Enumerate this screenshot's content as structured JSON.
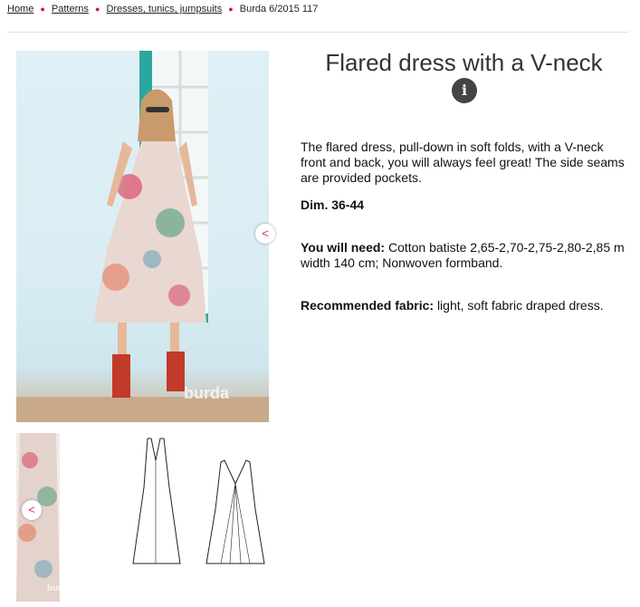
{
  "breadcrumb": {
    "items": [
      "Home",
      "Patterns",
      "Dresses, tunics, jumpsuits"
    ],
    "current": "Burda 6/2015 117"
  },
  "product": {
    "title": "Flared dress with a V-neck",
    "description": "The flared dress, pull-down in soft folds, with a V-neck front and back, you will always feel great! The side seams are provided pockets.",
    "dim": "Dim. 36-44",
    "need_label": "You will need:",
    "need_value": "Cotton batiste 2,65-2,70-2,75-2,80-2,85 m width 140 cm; Nonwoven formband.",
    "fabric_label": "Recommended fabric:",
    "fabric_value": "light, soft fabric draped dress."
  },
  "media": {
    "watermark_main": "burda",
    "watermark_thumb": "burda"
  },
  "icons": {
    "info": "info-icon",
    "share": "share-icon"
  },
  "colors": {
    "accent": "#e0245e",
    "separator": "#d8163c",
    "title": "#333333",
    "info_bg": "#444444"
  }
}
